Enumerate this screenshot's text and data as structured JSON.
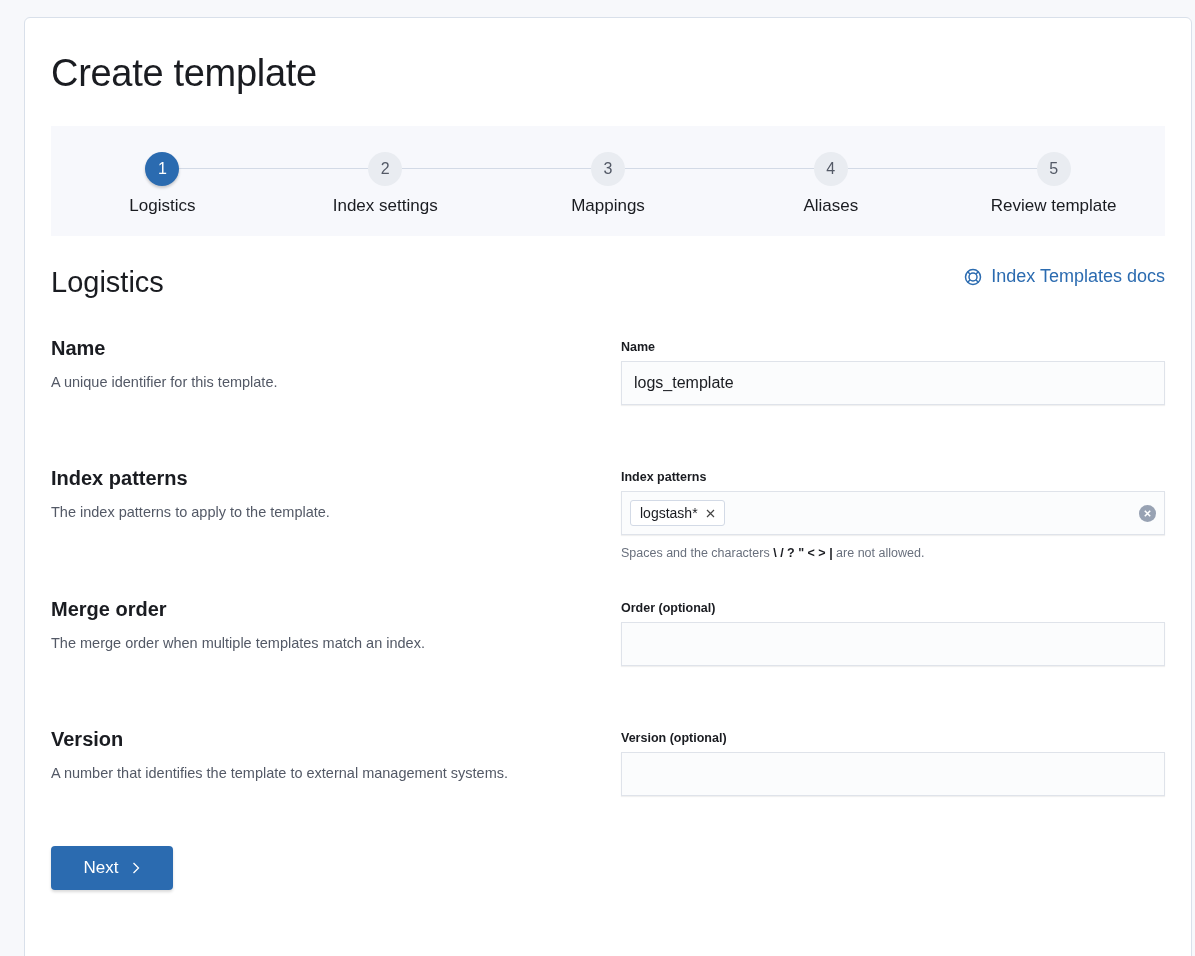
{
  "title": "Create template",
  "steps": [
    {
      "number": "1",
      "label": "Logistics",
      "selected": true
    },
    {
      "number": "2",
      "label": "Index settings",
      "selected": false
    },
    {
      "number": "3",
      "label": "Mappings",
      "selected": false
    },
    {
      "number": "4",
      "label": "Aliases",
      "selected": false
    },
    {
      "number": "5",
      "label": "Review template",
      "selected": false
    }
  ],
  "section_title": "Logistics",
  "docs_link": "Index Templates docs",
  "rows": [
    {
      "title": "Name",
      "description": "A unique identifier for this template.",
      "field_label": "Name",
      "kind": "text",
      "value": "logs_template"
    },
    {
      "title": "Index patterns",
      "description": "The index patterns to apply to the template.",
      "field_label": "Index patterns",
      "kind": "combo",
      "tags": [
        "logstash*"
      ],
      "help": "Spaces and the characters **\\ / ? \" < > |** are not allowed."
    },
    {
      "title": "Merge order",
      "description": "The merge order when multiple templates match an index.",
      "field_label": "Order (optional)",
      "kind": "text"
    },
    {
      "title": "Version",
      "description": "A number that identifies the template to external management systems.",
      "field_label": "Version (optional)",
      "kind": "text"
    }
  ],
  "next_button": "Next"
}
